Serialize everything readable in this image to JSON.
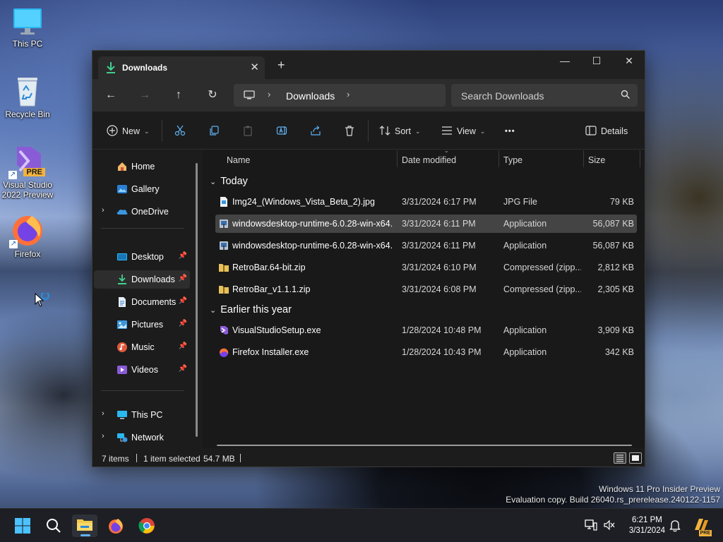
{
  "desktop": {
    "icons": [
      {
        "label": "This PC"
      },
      {
        "label": "Recycle Bin"
      },
      {
        "label": "Visual Studio 2022 Preview",
        "badge": "PRE"
      },
      {
        "label": "Firefox"
      }
    ]
  },
  "explorer": {
    "tab": {
      "label": "Downloads",
      "close": "✕",
      "new_tab": "+"
    },
    "window_controls": {
      "minimize": "—",
      "maximize": "☐",
      "close": "✕"
    },
    "address": {
      "crumb": "Downloads",
      "chevron": "›"
    },
    "search": {
      "placeholder": "Search Downloads"
    },
    "toolbar": {
      "new_label": "New",
      "sort_label": "Sort",
      "view_label": "View",
      "more_label": "•••",
      "details_label": "Details"
    },
    "sidebar": {
      "items": [
        {
          "label": "Home"
        },
        {
          "label": "Gallery"
        },
        {
          "label": "OneDrive"
        },
        {
          "label": "Desktop"
        },
        {
          "label": "Downloads"
        },
        {
          "label": "Documents"
        },
        {
          "label": "Pictures"
        },
        {
          "label": "Music"
        },
        {
          "label": "Videos"
        },
        {
          "label": "This PC"
        },
        {
          "label": "Network"
        }
      ]
    },
    "columns": {
      "name": "Name",
      "date": "Date modified",
      "type": "Type",
      "size": "Size"
    },
    "groups": {
      "today": "Today",
      "earlier": "Earlier this year"
    },
    "files": [
      {
        "name": "Img24_(Windows_Vista_Beta_2).jpg",
        "date": "3/31/2024 6:17 PM",
        "type": "JPG File",
        "size": "79 KB"
      },
      {
        "name": "windowsdesktop-runtime-6.0.28-win-x64...",
        "date": "3/31/2024 6:11 PM",
        "type": "Application",
        "size": "56,087 KB"
      },
      {
        "name": "windowsdesktop-runtime-6.0.28-win-x64...",
        "date": "3/31/2024 6:11 PM",
        "type": "Application",
        "size": "56,087 KB"
      },
      {
        "name": "RetroBar.64-bit.zip",
        "date": "3/31/2024 6:10 PM",
        "type": "Compressed (zipp...",
        "size": "2,812 KB"
      },
      {
        "name": "RetroBar_v1.1.1.zip",
        "date": "3/31/2024 6:08 PM",
        "type": "Compressed (zipp...",
        "size": "2,305 KB"
      },
      {
        "name": "VisualStudioSetup.exe",
        "date": "1/28/2024 10:48 PM",
        "type": "Application",
        "size": "3,909 KB"
      },
      {
        "name": "Firefox Installer.exe",
        "date": "1/28/2024 10:43 PM",
        "type": "Application",
        "size": "342 KB"
      }
    ],
    "status": {
      "items": "7 items",
      "selected": "1 item selected",
      "size": "54.7 MB"
    }
  },
  "watermark": {
    "line1": "Windows 11 Pro Insider Preview",
    "line2": "Evaluation copy. Build 26040.rs_prerelease.240122-1157"
  },
  "taskbar": {
    "time": "6:21 PM",
    "date": "3/31/2024",
    "pre_badge": "PRE",
    "accent": "#5fb2f2"
  }
}
